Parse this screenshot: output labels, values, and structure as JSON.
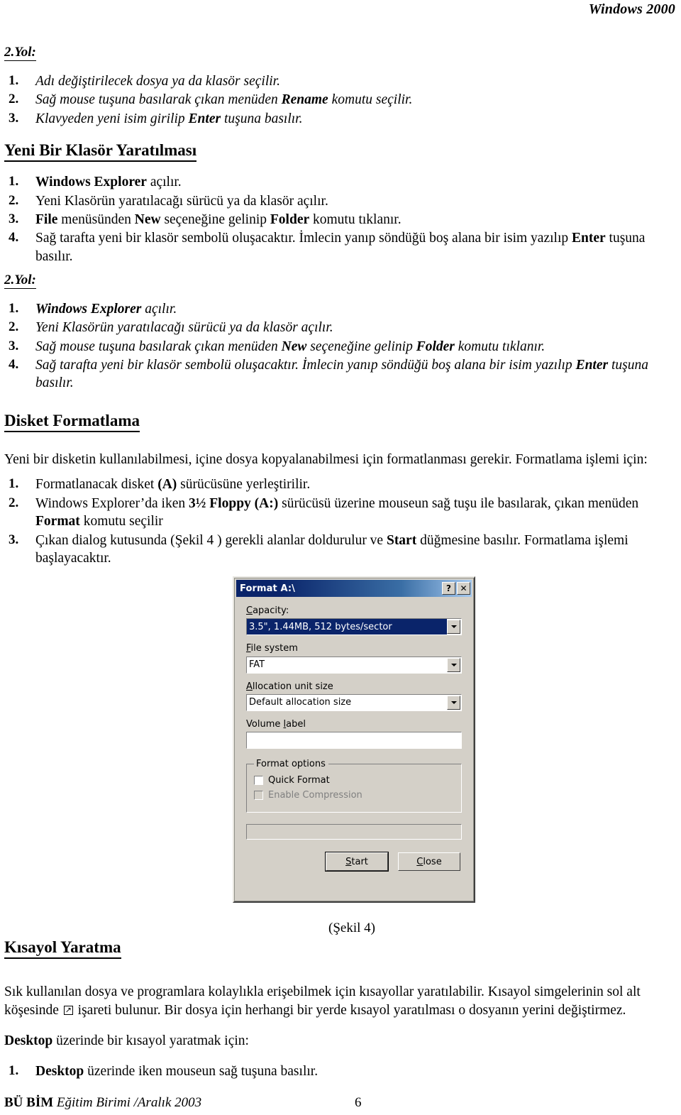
{
  "running_head": "Windows 2000",
  "sections": {
    "yol2_top": {
      "subhead": "2.Yol:",
      "steps": [
        {
          "num": "1.",
          "parts": [
            {
              "t": "Adı değiştirilecek dosya ya da klasör seçilir.",
              "b": false
            }
          ]
        },
        {
          "num": "2.",
          "parts": [
            {
              "t": "Sağ mouse tuşuna basılarak çıkan menüden ",
              "b": false
            },
            {
              "t": "Rename",
              "b": true
            },
            {
              "t": " komutu seçilir.",
              "b": false
            }
          ]
        },
        {
          "num": "3.",
          "parts": [
            {
              "t": "Klavyeden yeni isim girilip ",
              "b": false
            },
            {
              "t": "Enter",
              "b": true
            },
            {
              "t": " tuşuna basılır.",
              "b": false
            }
          ]
        }
      ]
    },
    "new_folder": {
      "heading": "Yeni Bir Klasör Yaratılması",
      "steps": [
        {
          "num": "1.",
          "parts": [
            {
              "t": "Windows Explorer",
              "b": true
            },
            {
              "t": " açılır.",
              "b": false
            }
          ]
        },
        {
          "num": "2.",
          "parts": [
            {
              "t": "Yeni Klasörün yaratılacağı sürücü ya da klasör açılır.",
              "b": false
            }
          ]
        },
        {
          "num": "3.",
          "parts": [
            {
              "t": "File",
              "b": true
            },
            {
              "t": " menüsünden ",
              "b": false
            },
            {
              "t": "New",
              "b": true
            },
            {
              "t": " seçeneğine gelinip ",
              "b": false
            },
            {
              "t": "Folder",
              "b": true
            },
            {
              "t": " komutu tıklanır.",
              "b": false
            }
          ]
        },
        {
          "num": "4.",
          "parts": [
            {
              "t": "Sağ tarafta yeni bir klasör sembolü oluşacaktır. İmlecin yanıp söndüğü boş alana bir isim yazılıp ",
              "b": false
            },
            {
              "t": "Enter",
              "b": true
            },
            {
              "t": " tuşuna basılır.",
              "b": false
            }
          ]
        }
      ]
    },
    "yol2_bottom": {
      "subhead": "2.Yol:",
      "steps": [
        {
          "num": "1.",
          "parts": [
            {
              "t": "Windows Explorer",
              "b": true
            },
            {
              "t": " açılır.",
              "b": false
            }
          ]
        },
        {
          "num": "2.",
          "parts": [
            {
              "t": "Yeni Klasörün yaratılacağı sürücü ya da klasör açılır.",
              "b": false
            }
          ]
        },
        {
          "num": "3.",
          "parts": [
            {
              "t": "Sağ mouse tuşuna basılarak çıkan menüden ",
              "b": false
            },
            {
              "t": "New",
              "b": true
            },
            {
              "t": " seçeneğine gelinip ",
              "b": false
            },
            {
              "t": "Folder",
              "b": true
            },
            {
              "t": " komutu tıklanır.",
              "b": false
            }
          ]
        },
        {
          "num": "4.",
          "parts": [
            {
              "t": "Sağ tarafta yeni bir klasör sembolü oluşacaktır. İmlecin yanıp söndüğü boş alana bir isim yazılıp ",
              "b": false
            },
            {
              "t": "Enter",
              "b": true
            },
            {
              "t": " tuşuna basılır.",
              "b": false
            }
          ]
        }
      ]
    },
    "format": {
      "heading": "Disket Formatlama",
      "intro": "Yeni bir disketin kullanılabilmesi, içine dosya kopyalanabilmesi  için formatlanması gerekir. Formatlama işlemi için:",
      "steps": [
        {
          "num": "1.",
          "parts": [
            {
              "t": "Formatlanacak disket ",
              "b": false
            },
            {
              "t": "(A)",
              "b": true
            },
            {
              "t": " sürücüsüne yerleştirilir.",
              "b": false
            }
          ]
        },
        {
          "num": "2.",
          "parts": [
            {
              "t": "Windows Explorer’da iken  ",
              "b": false
            },
            {
              "t": "3½  Floppy (A:)",
              "b": true
            },
            {
              "t": "   sürücüsü üzerine mouseun sağ tuşu  ile basılarak, çıkan menüden ",
              "b": false
            },
            {
              "t": "Format",
              "b": true
            },
            {
              "t": " komutu seçilir",
              "b": false
            }
          ]
        },
        {
          "num": "3.",
          "parts": [
            {
              "t": "Çıkan dialog kutusunda (Şekil 4 ) gerekli alanlar doldurulur ve ",
              "b": false
            },
            {
              "t": "Start",
              "b": true
            },
            {
              "t": " düğmesine basılır. Formatlama işlemi başlayacaktır.",
              "b": false
            }
          ]
        }
      ]
    },
    "shortcut": {
      "heading": "Kısayol Yaratma",
      "para_before": "Sık kullanılan dosya ve programlara kolaylıkla erişebilmek için kısayollar yaratılabilir. Kısayol simgelerinin sol alt köşesinde",
      "para_after": "işareti bulunur. Bir dosya için herhangi bir yerde kısayol yaratılması o dosyanın yerini değiştirmez.",
      "desktop_intro_bold": "Desktop",
      "desktop_intro_rest": " üzerinde bir kısayol yaratmak için:",
      "steps": [
        {
          "num": "1.",
          "parts": [
            {
              "t": "Desktop",
              "b": true
            },
            {
              "t": " üzerinde iken mouseun sağ tuşuna basılır.",
              "b": false
            }
          ]
        }
      ]
    }
  },
  "figure_caption": "(Şekil 4)",
  "dialog": {
    "title": "Format A:\\",
    "help_button": "?",
    "close_button": "✕",
    "capacity": {
      "label": "Capacity:",
      "value": "3.5\",  1.44MB, 512 bytes/sector",
      "selected": true
    },
    "file_system": {
      "label": "File system",
      "value": "FAT"
    },
    "allocation": {
      "label": "Allocation unit size",
      "value": "Default allocation size"
    },
    "volume_label": {
      "label": "Volume label",
      "value": ""
    },
    "format_options": {
      "legend": "Format options",
      "quick_format": {
        "label": "Quick Format",
        "checked": false,
        "enabled": true
      },
      "enable_compression": {
        "label": "Enable Compression",
        "checked": false,
        "enabled": false
      }
    },
    "progress_value": "",
    "buttons": {
      "start": "Start",
      "close": "Close"
    },
    "colors": {
      "face": "#d4d0c8",
      "titlebar_start": "#0a246a",
      "titlebar_end": "#a6caf0",
      "selection": "#0a246a",
      "disabled_text": "#808080"
    }
  },
  "footer": {
    "org": "BÜ BİM",
    "unit": " Eğitim Birimi /Aralık  2003",
    "page_number": "6"
  }
}
